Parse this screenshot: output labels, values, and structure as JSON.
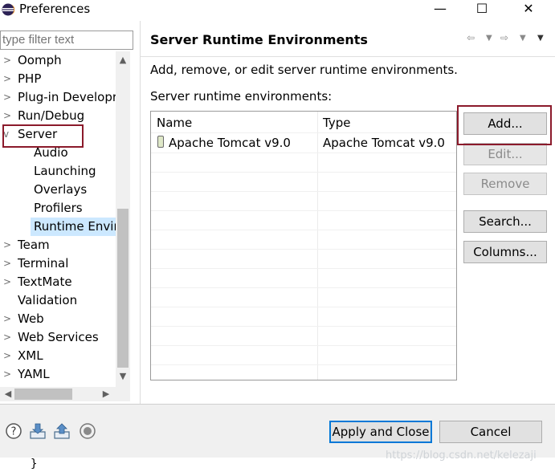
{
  "window": {
    "title": "Preferences",
    "controls": {
      "minimize": "—",
      "maximize": "☐",
      "close": "✕"
    }
  },
  "sidebar": {
    "filter_placeholder": "type filter text",
    "items": [
      {
        "label": "Oomph",
        "expanded": false,
        "level": 0
      },
      {
        "label": "PHP",
        "expanded": false,
        "level": 0
      },
      {
        "label": "Plug-in Developr",
        "expanded": false,
        "level": 0
      },
      {
        "label": "Run/Debug",
        "expanded": false,
        "level": 0
      },
      {
        "label": "Server",
        "expanded": true,
        "level": 0
      },
      {
        "label": "Audio",
        "level": 1
      },
      {
        "label": "Launching",
        "level": 1
      },
      {
        "label": "Overlays",
        "level": 1
      },
      {
        "label": "Profilers",
        "level": 1
      },
      {
        "label": "Runtime Envir",
        "level": 1,
        "selected": true
      },
      {
        "label": "Team",
        "expanded": false,
        "level": 0
      },
      {
        "label": "Terminal",
        "expanded": false,
        "level": 0
      },
      {
        "label": "TextMate",
        "expanded": false,
        "level": 0
      },
      {
        "label": "Validation",
        "level": 0
      },
      {
        "label": "Web",
        "expanded": false,
        "level": 0
      },
      {
        "label": "Web Services",
        "expanded": false,
        "level": 0
      },
      {
        "label": "XML",
        "expanded": false,
        "level": 0
      },
      {
        "label": "YAML",
        "expanded": false,
        "level": 0
      }
    ]
  },
  "main": {
    "title": "Server Runtime Environments",
    "description": "Add, remove, or edit server runtime environments.",
    "table_label": "Server runtime environments:",
    "columns": [
      "Name",
      "Type"
    ],
    "rows": [
      {
        "name": "Apache Tomcat v9.0",
        "type": "Apache Tomcat v9.0",
        "icon": "jar-icon"
      }
    ],
    "buttons": {
      "add": "Add...",
      "edit": "Edit...",
      "remove": "Remove",
      "search": "Search...",
      "columns": "Columns..."
    }
  },
  "footer": {
    "apply_close": "Apply and Close",
    "cancel": "Cancel",
    "icons": [
      "help-icon",
      "import-icon",
      "export-icon",
      "record-icon"
    ]
  },
  "background": {
    "brace": "}"
  },
  "watermark": "https://blog.csdn.net/kelezaji",
  "colors": {
    "selection": "#cce8ff",
    "highlight_box": "#8b1a2b",
    "default_button_border": "#0078d7"
  }
}
